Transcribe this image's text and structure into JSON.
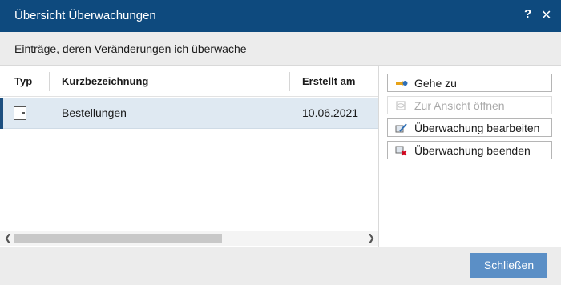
{
  "window": {
    "title": "Übersicht Überwachungen",
    "help": "?",
    "close": "✕"
  },
  "subtitle": "Einträge, deren Veränderungen ich überwache",
  "table": {
    "columns": {
      "typ": "Typ",
      "kurz": "Kurzbezeichnung",
      "erstellt": "Erstellt am"
    },
    "rows": [
      {
        "type_icon": "document-icon",
        "kurzbezeichnung": "Bestellungen",
        "erstellt_am": "10.06.2021",
        "selected": true
      }
    ]
  },
  "actions": {
    "goto": "Gehe zu",
    "open_view": "Zur Ansicht öffnen",
    "edit": "Überwachung bearbeiten",
    "end": "Überwachung beenden"
  },
  "footer": {
    "close_button": "Schließen"
  },
  "colors": {
    "titlebar": "#0e4a7e",
    "primary_button": "#5b8fc6",
    "selection": "#dfe9f2"
  }
}
